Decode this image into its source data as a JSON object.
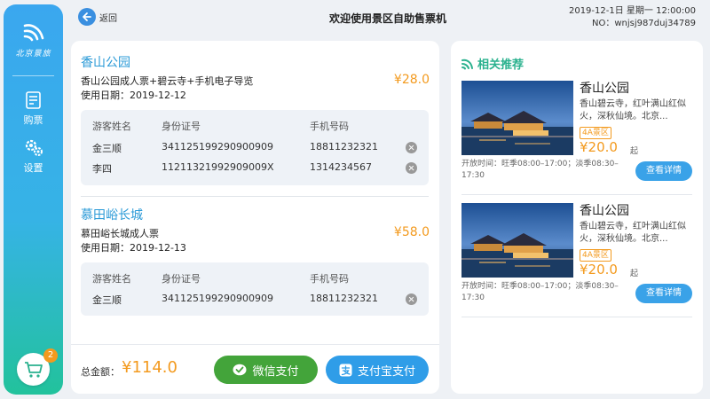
{
  "sidebar": {
    "logo_text": "北京景旅",
    "items": [
      {
        "label": "购票",
        "icon": "ticket-icon"
      },
      {
        "label": "设置",
        "icon": "gear-icon"
      }
    ],
    "cart_count": "2"
  },
  "header": {
    "back_label": "返回",
    "title": "欢迎使用景区自助售票机",
    "datetime": "2019-12-1日  星期一  12:00:00",
    "serial": "NO：wnjsj987duj34789"
  },
  "order": {
    "visitor_headers": [
      "游客姓名",
      "身份证号",
      "手机号码"
    ],
    "groups": [
      {
        "site": "香山公园",
        "ticket": "香山公园成人票+碧云寺+手机电子导览",
        "use_date": "使用日期：2019-12-12",
        "price": "¥28.0",
        "visitors": [
          {
            "name": "金三顺",
            "id": "341125199290900909",
            "phone": "18811232321"
          },
          {
            "name": "李四",
            "id": "11211321992909009X",
            "phone": "1314234567"
          }
        ]
      },
      {
        "site": "慕田峪长城",
        "ticket": "慕田峪长城成人票",
        "use_date": "使用日期：2019-12-13",
        "price": "¥58.0",
        "visitors": [
          {
            "name": "金三顺",
            "id": "341125199290900909",
            "phone": "18811232321"
          }
        ]
      }
    ],
    "total_label": "总金额：",
    "total_value": "¥114.0",
    "wechat_label": "微信支付",
    "alipay_label": "支付宝支付"
  },
  "recommend": {
    "title": "相关推荐",
    "items": [
      {
        "name": "香山公园",
        "desc": "香山碧云寺，红叶满山红似火，深秋仙境。北京...",
        "badge": "4A景区",
        "price": "¥20.0",
        "unit": "起",
        "hours": "开放时间：旺季08:00–17:00；淡季08:30–17:30",
        "detail_label": "查看详情"
      },
      {
        "name": "香山公园",
        "desc": "香山碧云寺，红叶满山红似火，深秋仙境。北京...",
        "badge": "4A景区",
        "price": "¥20.0",
        "unit": "起",
        "hours": "开放时间：旺季08:00–17:00；淡季08:30–17:30",
        "detail_label": "查看详情"
      }
    ]
  },
  "colors": {
    "accent_blue": "#2a9ad7",
    "price_orange": "#f39a1e",
    "wechat_green": "#43a43a",
    "alipay_blue": "#2f9de8",
    "recommend_green": "#2ab18e"
  }
}
